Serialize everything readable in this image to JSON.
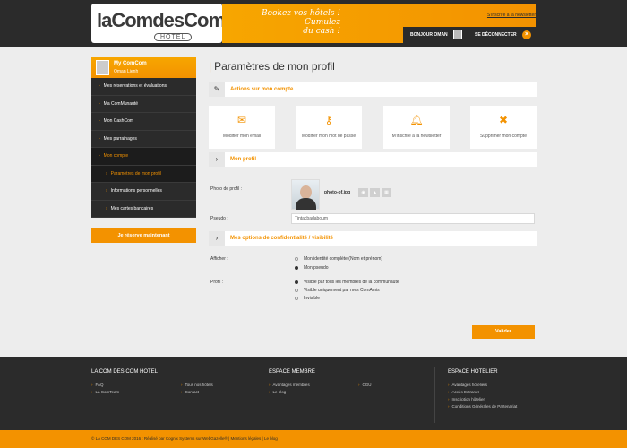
{
  "header": {
    "logo_text": "laComdesCom",
    "logo_sub": "HOTEL",
    "slogan_1": "Bookez vos hôtels !",
    "slogan_2": "Cumulez",
    "slogan_3": "du cash !",
    "newsletter_link": "S'inscrire à la newsletter",
    "greeting": "BONJOUR OMAN",
    "logout": "SE DÉCONNECTER",
    "logout_icon": "×"
  },
  "sidebar": {
    "title": "My ComCom",
    "user": "Oman Lienh",
    "items": [
      {
        "label": "Mes réservations et évaluations"
      },
      {
        "label": "Ma ComMunauté"
      },
      {
        "label": "Mon CashCom"
      },
      {
        "label": "Mes parrainages"
      },
      {
        "label": "Mon compte"
      },
      {
        "label": "Paramètres de mon profil"
      },
      {
        "label": "Informations personnelles"
      },
      {
        "label": "Mes cartes bancaires"
      }
    ],
    "reserve_button": "Je réserve maintenant"
  },
  "main": {
    "title": "Paramètres de mon profil",
    "section_actions": "Actions sur mon compte",
    "actions": [
      {
        "label": "Modifier mon email",
        "icon": "envelope-icon"
      },
      {
        "label": "Modifier mon mot de passe",
        "icon": "key-icon"
      },
      {
        "label": "M'inscrire à la newsletter",
        "icon": "bell-icon"
      },
      {
        "label": "Supprimer mon compte",
        "icon": "remove-user-icon"
      }
    ],
    "section_profile": "Mon profil",
    "photo_label": "Photo de profil :",
    "photo_filename": "photo-of.jpg",
    "pseudo_label": "Pseudo :",
    "pseudo_value": "Tintacbadaboum",
    "section_privacy": "Mes options de confidentialité / visibilité",
    "afficher_label": "Afficher :",
    "afficher_options": [
      {
        "label": "Mon identité complète (Nom et prénom)",
        "checked": false
      },
      {
        "label": "Mon pseudo",
        "checked": true
      }
    ],
    "profil_label": "Profil :",
    "profil_options": [
      {
        "label": "Visible par tous les membres de la communauté",
        "checked": true
      },
      {
        "label": "Visible uniquement par mes ComAmis",
        "checked": false
      },
      {
        "label": "Invisible",
        "checked": false
      }
    ],
    "validate_button": "Valider"
  },
  "footer": {
    "col1_title": "LA COM DES COM HOTEL",
    "col1_a": [
      "FAQ",
      "La ComTeam"
    ],
    "col1_b": [
      "Tous nos hôtels",
      "Contact"
    ],
    "col2_title": "ESPACE MEMBRE",
    "col2_a": [
      "Avantages membres",
      "Le blog"
    ],
    "col2_b": [
      "CGU"
    ],
    "col3_title": "ESPACE HOTELIER",
    "col3_a": [
      "Avantages hôteliers",
      "Accès Extranet",
      "Inscription hôtelier",
      "Conditions Générales de Partenariat"
    ],
    "copyright": "© LA COM DES COM 2016 : Réalisé par Cognix Systems sur WebGazelle® | Mentions légales | Le blog"
  }
}
